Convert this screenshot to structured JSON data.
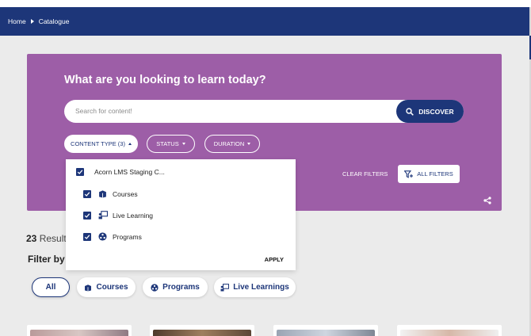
{
  "breadcrumb": {
    "home": "Home",
    "current": "Catalogue"
  },
  "hero": {
    "title": "What are you looking to learn today?",
    "search_placeholder": "Search for content!",
    "discover_label": "DISCOVER",
    "filters": [
      {
        "label": "CONTENT TYPE (3)",
        "state": "expanded"
      },
      {
        "label": "STATUS",
        "state": "collapsed"
      },
      {
        "label": "DURATION",
        "state": "collapsed"
      }
    ],
    "clear_filters_label": "CLEAR FILTERS",
    "all_filters_label": "ALL FILTERS"
  },
  "dropdown": {
    "parent": {
      "label": "Acorn LMS Staging C...",
      "checked": true
    },
    "items": [
      {
        "label": "Courses",
        "icon": "courses-icon",
        "checked": true
      },
      {
        "label": "Live Learning",
        "icon": "live-learning-icon",
        "checked": true
      },
      {
        "label": "Programs",
        "icon": "programs-icon",
        "checked": true
      }
    ],
    "apply_label": "APPLY"
  },
  "results": {
    "count": "23",
    "label": "Result"
  },
  "filter_by": {
    "label": "Filter by"
  },
  "chips": [
    {
      "label": "All",
      "selected": true
    },
    {
      "label": "Courses",
      "icon": "courses-icon"
    },
    {
      "label": "Programs",
      "icon": "programs-icon"
    },
    {
      "label": "Live Learnings",
      "icon": "live-learning-icon"
    }
  ],
  "colors": {
    "navy": "#1d3679",
    "hero": "#9d5ea7",
    "background": "#ebebeb"
  }
}
